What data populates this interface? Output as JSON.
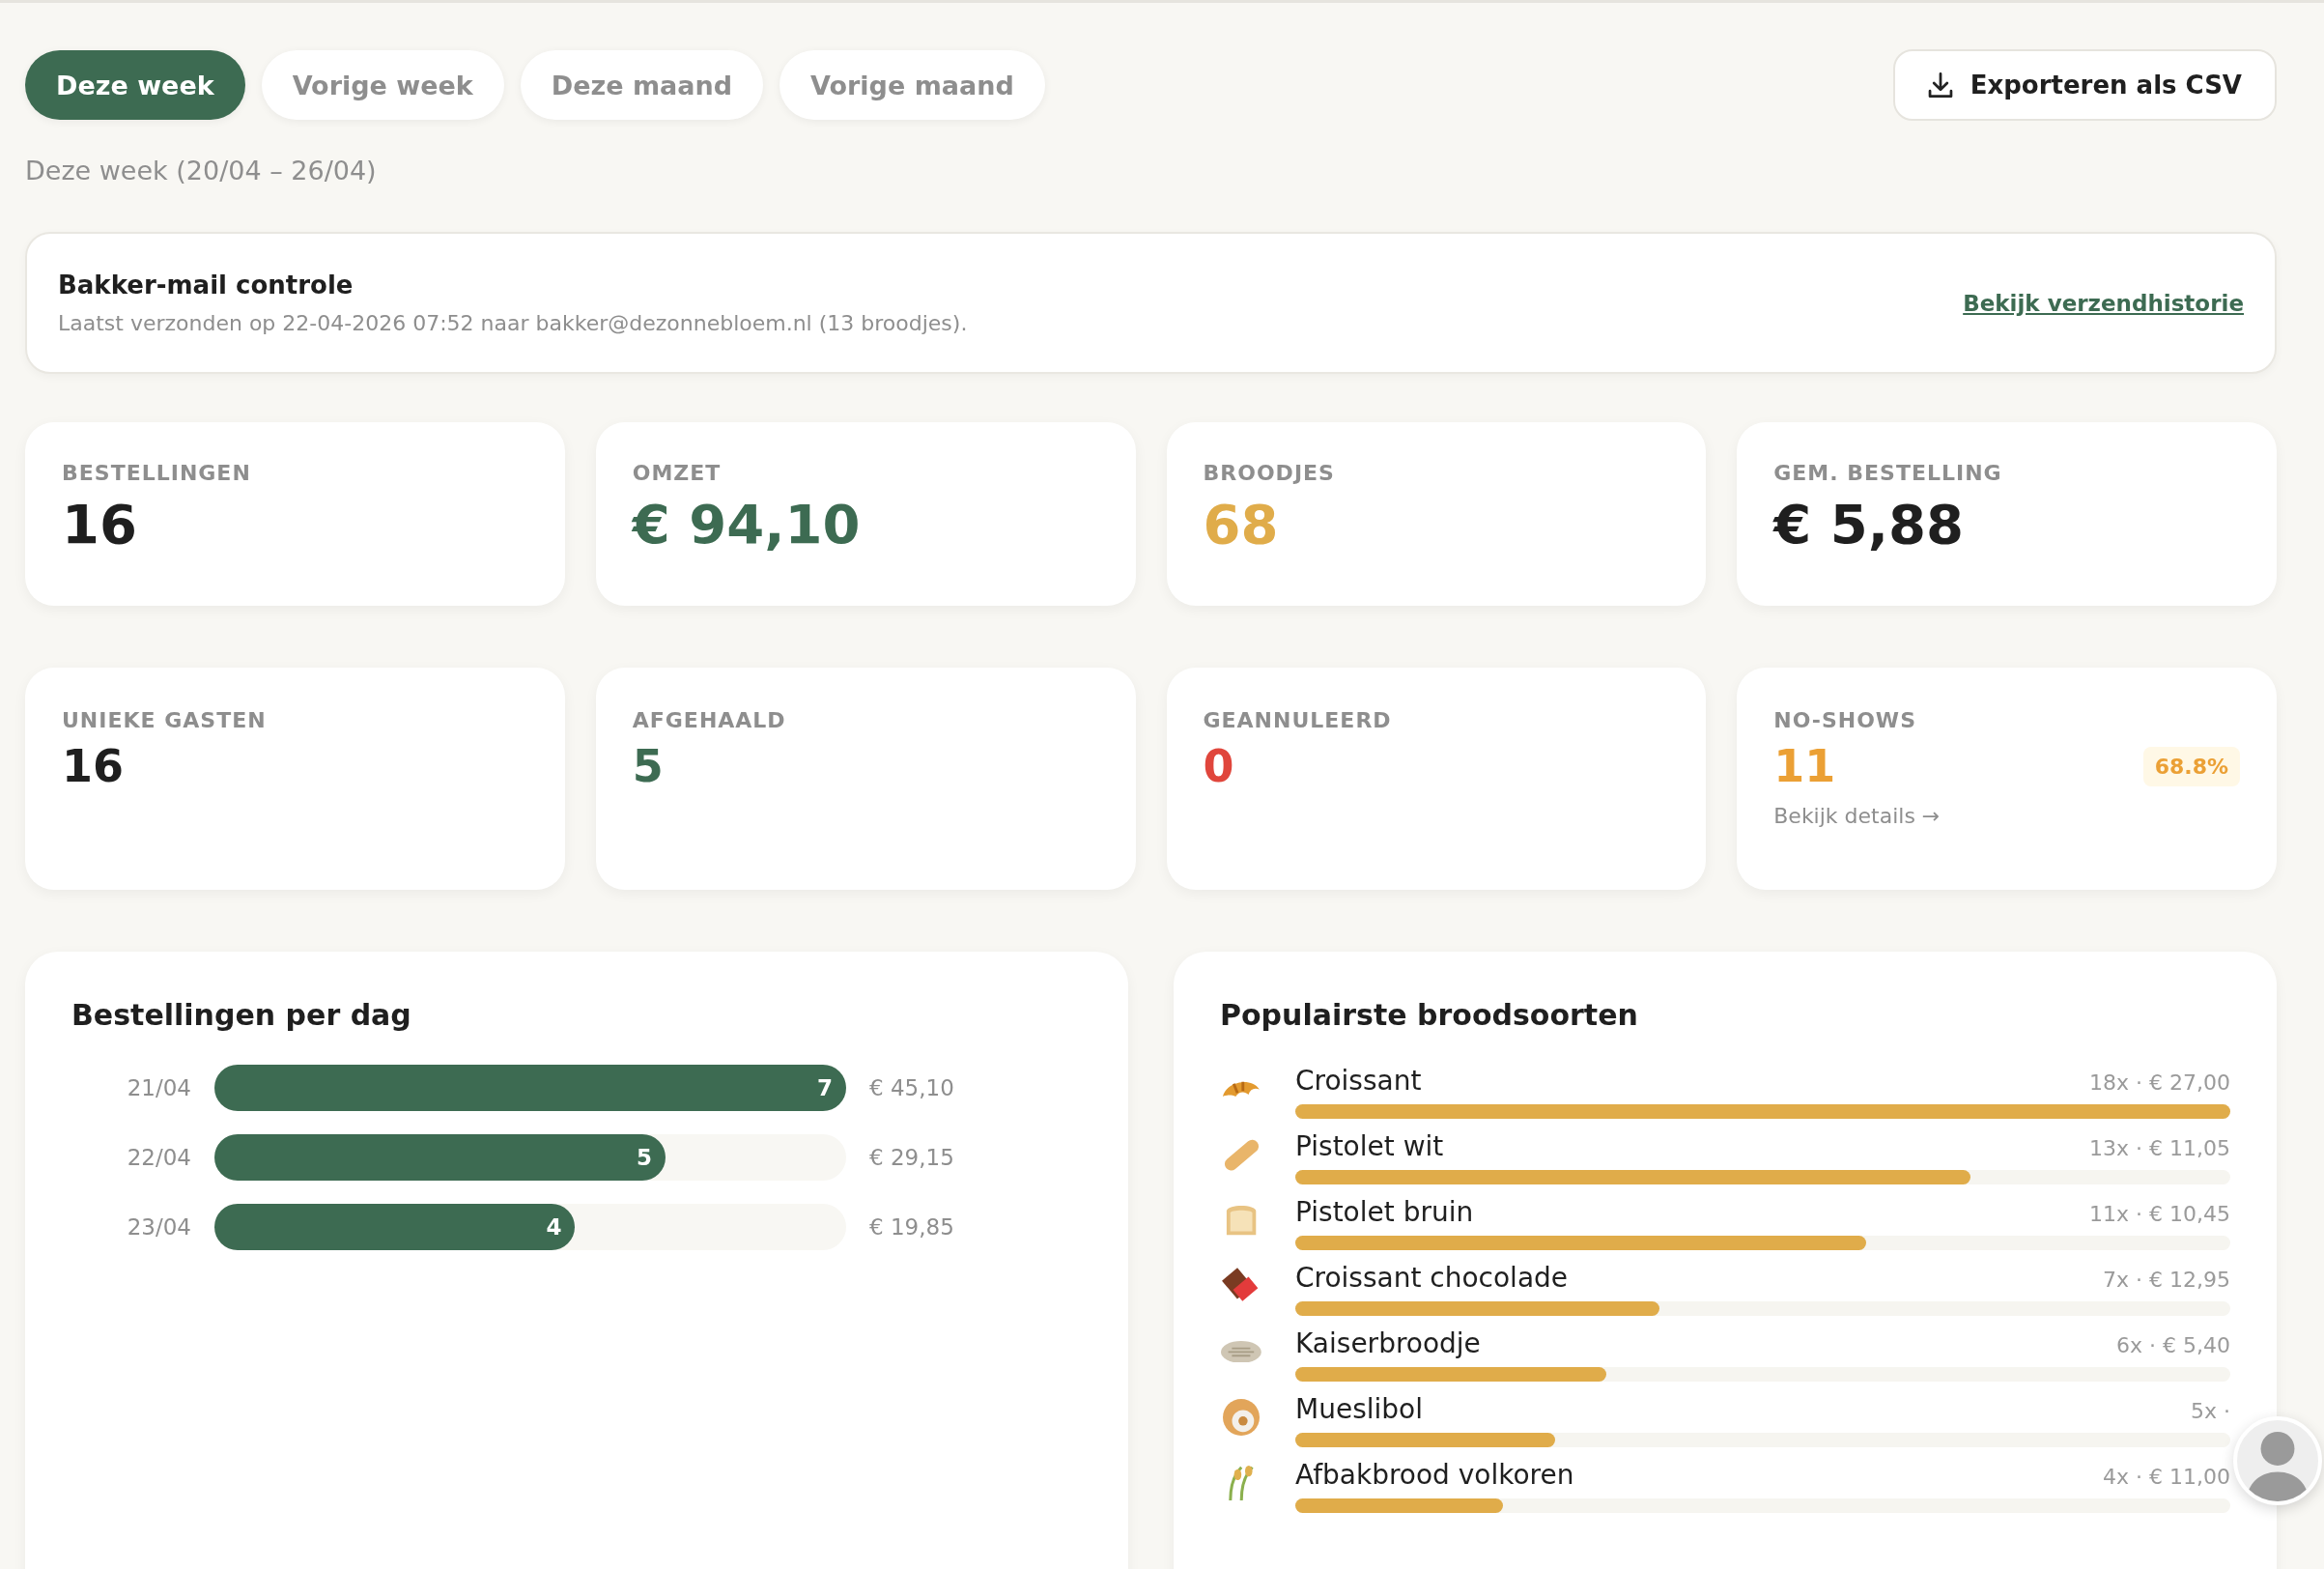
{
  "periods": [
    {
      "label": "Deze week",
      "selected": true
    },
    {
      "label": "Vorige week",
      "selected": false
    },
    {
      "label": "Deze maand",
      "selected": false
    },
    {
      "label": "Vorige maand",
      "selected": false
    }
  ],
  "export_button": "Exporteren als CSV",
  "period_caption": "Deze week (20/04 – 26/04)",
  "mail_check": {
    "title": "Bakker-mail controle",
    "text": "Laatst verzonden op 22-04-2026 07:52 naar bakker@dezonnebloem.nl (13 broodjes).",
    "link": "Bekijk verzendhistorie"
  },
  "main_stats": [
    {
      "label": "BESTELLINGEN",
      "value": "16",
      "color": "#1f1f1f"
    },
    {
      "label": "OMZET",
      "value": "€ 94,10",
      "color": "#3d6b52"
    },
    {
      "label": "BROODJES",
      "value": "68",
      "color": "#e0ac4a"
    },
    {
      "label": "GEM. BESTELLING",
      "value": "€ 5,88",
      "color": "#1f1f1f"
    }
  ],
  "detail_stats": [
    {
      "label": "UNIEKE GASTEN",
      "value": "16",
      "color": "#1f1f1f"
    },
    {
      "label": "AFGEHAALD",
      "value": "5",
      "color": "#3d6b52"
    },
    {
      "label": "GEANNULEERD",
      "value": "0",
      "color": "#e0463c"
    },
    {
      "label": "NO-SHOWS",
      "value": "11",
      "color": "#eba035",
      "badge": "68.8%",
      "link": "Bekijk details →"
    }
  ],
  "orders_per_day": {
    "title": "Bestellingen per dag",
    "rows": [
      {
        "day": "21/04",
        "count": "7",
        "level": 1,
        "amount": "€ 45,10"
      },
      {
        "day": "22/04",
        "count": "5",
        "level": 0.714,
        "amount": "€ 29,15"
      },
      {
        "day": "23/04",
        "count": "4",
        "level": 0.571,
        "amount": "€ 19,85"
      }
    ]
  },
  "popular": {
    "title": "Populairste broodsoorten",
    "items": [
      {
        "kind": "croissant",
        "name": "Croissant",
        "reading": "18x · € 27,00",
        "level": 1
      },
      {
        "kind": "baguette",
        "name": "Pistolet wit",
        "reading": "13x · € 11,05",
        "level": 0.722
      },
      {
        "kind": "loaf",
        "name": "Pistolet bruin",
        "reading": "11x · € 10,45",
        "level": 0.611
      },
      {
        "kind": "chocolate",
        "name": "Croissant chocolade",
        "reading": "7x · € 12,95",
        "level": 0.389
      },
      {
        "kind": "flatbread",
        "name": "Kaiserbroodje",
        "reading": "6x · € 5,40",
        "level": 0.333
      },
      {
        "kind": "bagel",
        "name": "Mueslibol",
        "reading": "5x ·",
        "level": 0.278
      },
      {
        "kind": "grain",
        "name": "Afbakbrood volkoren",
        "reading": "4x · € 11,00",
        "level": 0.222
      }
    ]
  }
}
